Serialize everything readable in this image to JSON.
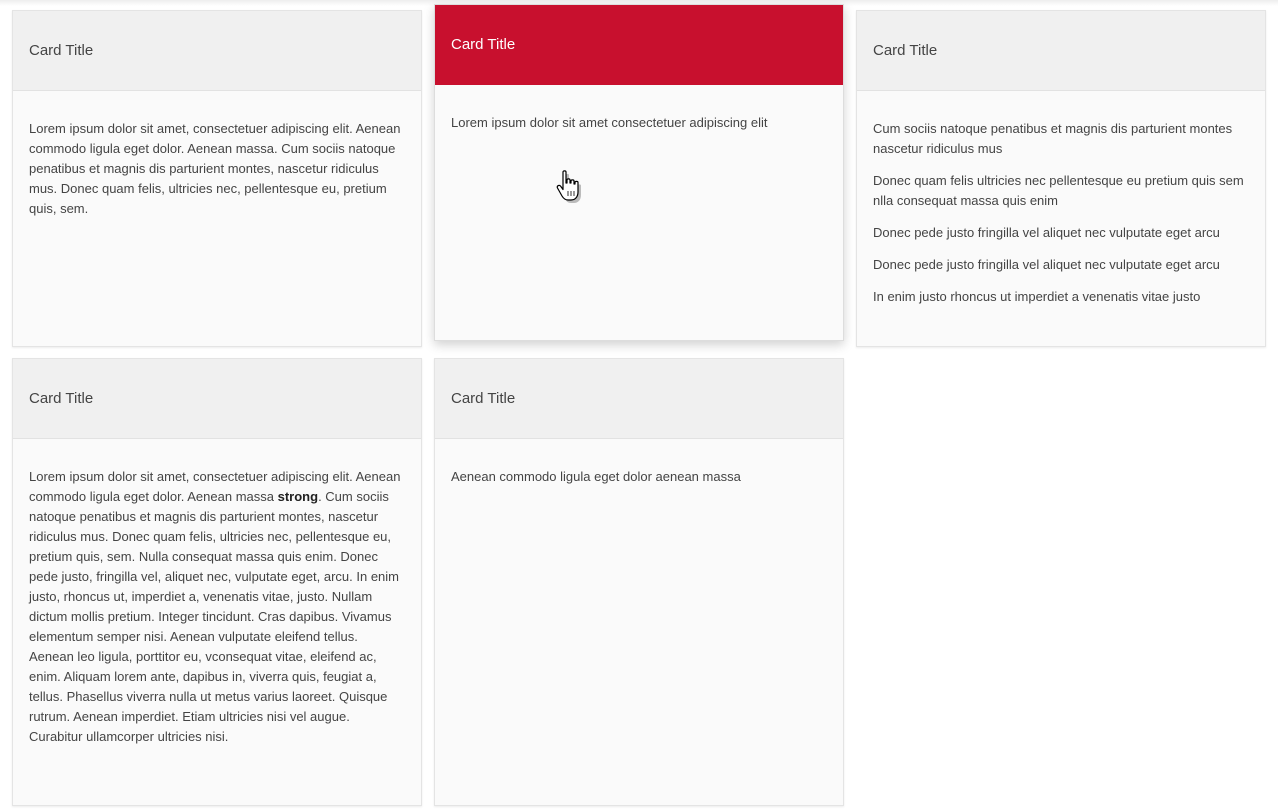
{
  "colors": {
    "accent": "#c8102e",
    "card_header_bg": "#f0f0f0",
    "card_bg": "#fafafa",
    "text": "#444444"
  },
  "cursor": {
    "icon": "hand-pointer-icon"
  },
  "cards": [
    {
      "title": "Card Title",
      "paragraphs": [
        "Lorem ipsum dolor sit amet, consectetuer adipiscing elit. Aenean commodo ligula eget dolor. Aenean massa. Cum sociis natoque penatibus et magnis dis parturient montes, nascetur ridiculus mus. Donec quam felis, ultricies nec, pellentesque eu, pretium quis, sem."
      ]
    },
    {
      "title": "Card Title",
      "active": true,
      "paragraphs": [
        "Lorem ipsum dolor sit amet consectetuer adipiscing elit"
      ]
    },
    {
      "title": "Card Title",
      "paragraphs": [
        "Cum sociis natoque penatibus et magnis dis parturient montes nascetur ridiculus mus",
        "Donec quam felis ultricies nec pellentesque eu pretium quis sem nlla consequat massa quis enim",
        "Donec pede justo fringilla vel aliquet nec vulputate eget arcu",
        "Donec pede justo fringilla vel aliquet nec vulputate eget arcu",
        "In enim justo rhoncus ut imperdiet a venenatis vitae justo"
      ]
    },
    {
      "title": "Card Title",
      "body_before_strong": "Lorem ipsum dolor sit amet, consectetuer adipiscing elit. Aenean commodo ligula eget dolor. Aenean massa ",
      "body_strong": "strong",
      "body_after_strong": ". Cum sociis natoque penatibus et magnis dis parturient montes, nascetur ridiculus mus. Donec quam felis, ultricies nec, pellentesque eu, pretium quis, sem. Nulla consequat massa quis enim. Donec pede justo, fringilla vel, aliquet nec, vulputate eget, arcu. In enim justo, rhoncus ut, imperdiet a, venenatis vitae, justo. Nullam dictum mollis pretium. Integer tincidunt. Cras dapibus. Vivamus elementum semper nisi. Aenean vulputate eleifend tellus. Aenean leo ligula, porttitor eu, vconsequat vitae, eleifend ac, enim. Aliquam lorem ante, dapibus in, viverra quis, feugiat a, tellus. Phasellus viverra nulla ut metus varius laoreet. Quisque rutrum. Aenean imperdiet. Etiam ultricies nisi vel augue. Curabitur ullamcorper ultricies nisi."
    },
    {
      "title": "Card Title",
      "paragraphs": [
        "Aenean commodo ligula eget dolor aenean massa"
      ]
    }
  ]
}
